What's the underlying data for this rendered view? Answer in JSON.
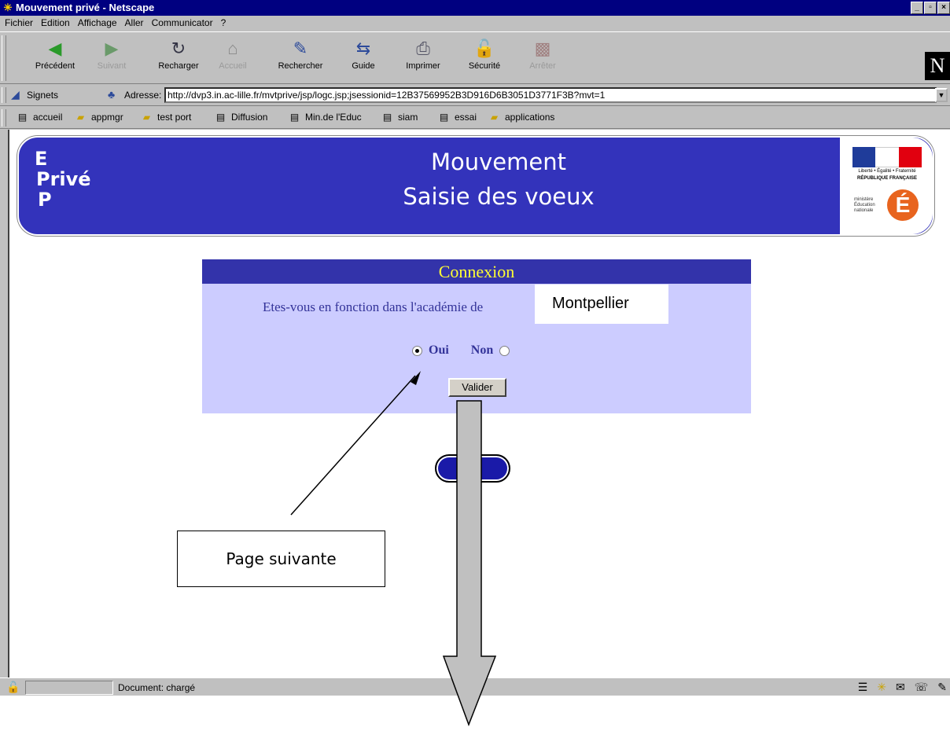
{
  "window": {
    "title": "Mouvement privé - Netscape",
    "buttons": [
      "_",
      "▫",
      "×"
    ]
  },
  "menu": [
    "Fichier",
    "Edition",
    "Affichage",
    "Aller",
    "Communicator",
    "?"
  ],
  "toolbar": [
    {
      "label": "Précédent",
      "icon": "back-arrow-icon",
      "disabled": false
    },
    {
      "label": "Suivant",
      "icon": "forward-arrow-icon",
      "disabled": true
    },
    {
      "label": "Recharger",
      "icon": "reload-icon",
      "disabled": false
    },
    {
      "label": "Accueil",
      "icon": "home-icon",
      "disabled": true
    },
    {
      "label": "Rechercher",
      "icon": "search-icon",
      "disabled": false
    },
    {
      "label": "Guide",
      "icon": "guide-icon",
      "disabled": false
    },
    {
      "label": "Imprimer",
      "icon": "printer-icon",
      "disabled": false
    },
    {
      "label": "Sécurité",
      "icon": "lock-icon",
      "disabled": false
    },
    {
      "label": "Arrêter",
      "icon": "stop-icon",
      "disabled": true
    }
  ],
  "location": {
    "bookmarks_label": "Signets",
    "address_label": "Adresse:",
    "url": "http://dvp3.in.ac-lille.fr/mvtprive/jsp/logc.jsp;jsessionid=12B37569952B3D916D6B3051D3771F3B?mvt=1"
  },
  "bookmarks": [
    "accueil",
    "appmgr",
    "test port",
    "Diffusion",
    "Min.de l'Educ",
    "siam",
    "essai",
    "applications"
  ],
  "banner": {
    "letters": [
      "E",
      "Privé",
      "P"
    ],
    "title": "Mouvement",
    "subtitle": "Saisie des voeux",
    "flag_colors": [
      "#1f3c9a",
      "#ffffff",
      "#e1000f"
    ],
    "flag_text": "Liberté • Égalité • Fraternité",
    "flag_caption": "RÉPUBLIQUE FRANÇAISE",
    "ministry": [
      "ministère",
      "Éducation",
      "nationale"
    ],
    "ministry_logo": "É"
  },
  "connexion": {
    "heading": "Connexion",
    "question": "Etes-vous en fonction dans l'académie de",
    "question_end": "?",
    "option_yes": "Oui",
    "option_no": "Non",
    "selected": "Oui",
    "submit": "Valider"
  },
  "overlay_label": "Montpellier",
  "callout": "Page suivante",
  "status": {
    "text": "Document: chargé"
  }
}
